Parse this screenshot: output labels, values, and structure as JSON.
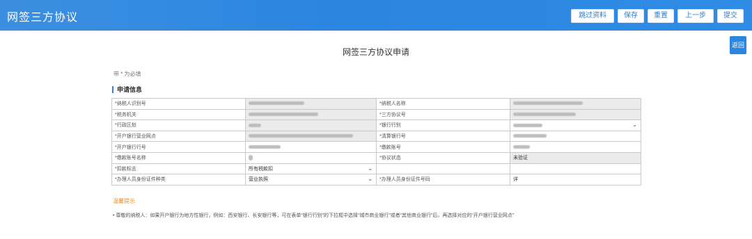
{
  "header": {
    "title": "网签三方协议",
    "buttons": [
      "跳过资料",
      "保存",
      "重置",
      "上一步",
      "提交"
    ]
  },
  "side_button": "返回",
  "page_title": "网签三方协议申请",
  "note": "带 * 为必填",
  "section_title": "申请信息",
  "rows": [
    {
      "l1": "*纳税人识别号",
      "v1": "",
      "l2": "*纳税人名称",
      "v2": ""
    },
    {
      "l1": "*税务机关",
      "v1": "",
      "l2": "*三方协议号",
      "v2": ""
    },
    {
      "l1": "*行政区划",
      "v1": "",
      "l2": "*银行行别",
      "v2": ""
    },
    {
      "l1": "*开户银行营业网点",
      "v1": "",
      "l2": "*清算银行号",
      "v2": ""
    },
    {
      "l1": "*开户银行行号",
      "v1": "",
      "l2": "*缴款账号",
      "v2": ""
    },
    {
      "l1": "*缴款账号名称",
      "v1": "",
      "l2": "*协议状态",
      "v2": "未验证"
    },
    {
      "l1": "*扣款标志",
      "v1": "所有税款扣",
      "l2": "",
      "v2": ""
    },
    {
      "l1": "*办理人员身份证件种类",
      "v1": "营业执照",
      "l2": "*办理人员身份证件号码",
      "v2": "详"
    }
  ],
  "tips": {
    "title": "温馨提示",
    "text": "•  尊敬的纳税人：如果开户银行为地方性银行，例如：西安银行、长安银行等，可在表单“银行行别”的下拉框中选择“城市商业银行”或者“其他商业银行”后，再选择对应的“开户银行营业网点”"
  }
}
